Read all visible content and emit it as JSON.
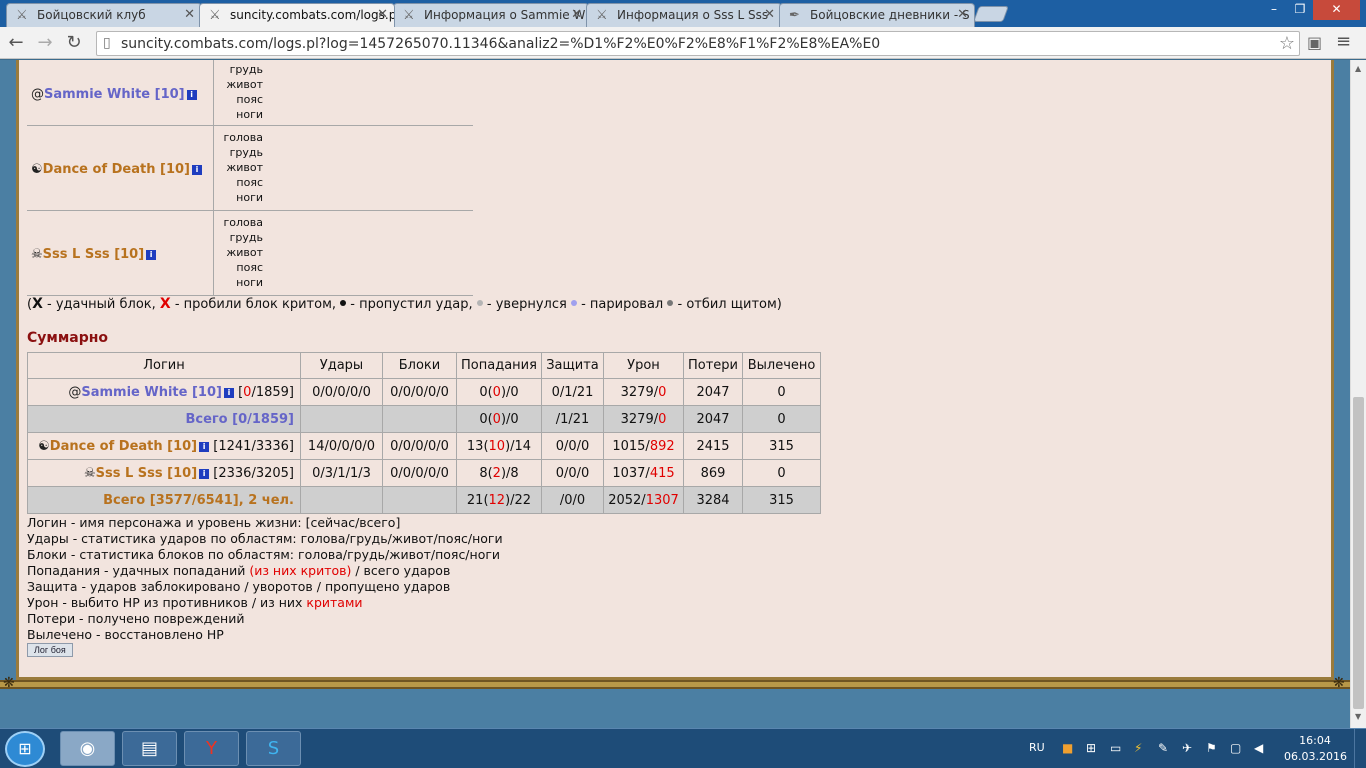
{
  "browser": {
    "tabs": [
      {
        "label": "Бойцовский клуб",
        "active": false
      },
      {
        "label": "suncity.combats.com/logs.p",
        "active": true
      },
      {
        "label": "Информация о Sammie W",
        "active": false
      },
      {
        "label": "Информация о Sss L Sss",
        "active": false
      },
      {
        "label": "Бойцовские дневники - S",
        "active": false
      }
    ],
    "url": "suncity.combats.com/logs.pl?log=1457265070.11346&analiz2=%D1%F2%E0%F2%E8%F1%F2%E8%EA%E0"
  },
  "players": [
    {
      "name": "Sammie White [10]",
      "color": "#6565c8",
      "icon": "shield-spiral-icon",
      "zones": [
        "грудь",
        "живот",
        "пояс",
        "ноги"
      ]
    },
    {
      "name": "Dance of Death [10]",
      "color": "#b8721e",
      "icon": "yin-yang-icon",
      "zones": [
        "голова",
        "грудь",
        "живот",
        "пояс",
        "ноги"
      ]
    },
    {
      "name": "Sss L Sss [10]",
      "color": "#b8721e",
      "icon": "demon-mask-icon",
      "zones": [
        "голова",
        "грудь",
        "живот",
        "пояс",
        "ноги"
      ]
    }
  ],
  "legend": {
    "block_mark": "X",
    "block_text": " - удачный блок, ",
    "crit_mark": "X",
    "crit_text": " - пробили блок критом, ",
    "miss_text": " - пропустил удар, ",
    "dodge_text": " - увернулся ",
    "parry_text": " - парировал ",
    "shield_text": " - отбил щитом)"
  },
  "summary": {
    "title": "Суммарно",
    "headers": [
      "Логин",
      "Удары",
      "Блоки",
      "Попадания",
      "Защита",
      "Урон",
      "Потери",
      "Вылечено"
    ],
    "rows": [
      {
        "type": "player",
        "team": "blue",
        "icon": "shield-spiral-icon",
        "name": "Sammie White [10]",
        "hp_now": "0",
        "hp_total": "/1859]",
        "hits": "0/0/0/0/0",
        "blocks": "0/0/0/0/0",
        "succ_a": "0(",
        "succ_crit": "0",
        "succ_b": ")/0",
        "defense": "0/1/21",
        "dmg_a": "3279/",
        "dmg_crit": "0",
        "losses": "2047",
        "healed": "0"
      },
      {
        "type": "total",
        "team": "blue",
        "label": "Всего [0/1859]",
        "succ_a": "0(",
        "succ_crit": "0",
        "succ_b": ")/0",
        "defense": "/1/21",
        "dmg_a": "3279/",
        "dmg_crit": "0",
        "losses": "2047",
        "healed": "0"
      },
      {
        "type": "player",
        "team": "brown",
        "icon": "yin-yang-icon",
        "name": "Dance of Death [10]",
        "hp_now": "1241",
        "hp_total": "/3336]",
        "hits": "14/0/0/0/0",
        "blocks": "0/0/0/0/0",
        "succ_a": "13(",
        "succ_crit": "10",
        "succ_b": ")/14",
        "defense": "0/0/0",
        "dmg_a": "1015/",
        "dmg_crit": "892",
        "losses": "2415",
        "healed": "315"
      },
      {
        "type": "player",
        "team": "brown",
        "icon": "demon-mask-icon",
        "name": "Sss L Sss [10]",
        "hp_now": "2336",
        "hp_total": "/3205]",
        "hits": "0/3/1/1/3",
        "blocks": "0/0/0/0/0",
        "succ_a": "8(",
        "succ_crit": "2",
        "succ_b": ")/8",
        "defense": "0/0/0",
        "dmg_a": "1037/",
        "dmg_crit": "415",
        "losses": "869",
        "healed": "0"
      },
      {
        "type": "total",
        "team": "brown",
        "label": "Всего [3577/6541], 2 чел.",
        "succ_a": "21(",
        "succ_crit": "12",
        "succ_b": ")/22",
        "defense": "/0/0",
        "dmg_a": "2052/",
        "dmg_crit": "1307",
        "losses": "3284",
        "healed": "315"
      }
    ]
  },
  "notes": {
    "login": "Логин - имя персонажа и уровень жизни: [сейчас/всего]",
    "hits": "Удары - статистика ударов по областям: голова/грудь/живот/пояс/ноги",
    "blocks": "Блоки - статистика блоков по областям: голова/грудь/живот/пояс/ноги",
    "succ_a": "Попадания - удачных попаданий ",
    "succ_red": "(из них критов)",
    "succ_b": " / всего ударов",
    "defense": "Защита - ударов заблокировано / уворотов / пропущено ударов",
    "dmg_a": "Урон - выбито HP из противников / из них ",
    "dmg_red": "критами",
    "losses": "Потери - получено повреждений",
    "healed": "Вылечено - восстановлено HP"
  },
  "log_button": "Лог боя",
  "taskbar": {
    "lang": "RU",
    "time": "16:04",
    "date": "06.03.2016"
  },
  "colors": {
    "blue_team": "#6565c8",
    "brown_team": "#b8721e",
    "crit_red": "#e00000",
    "section_title": "#8b1010"
  }
}
